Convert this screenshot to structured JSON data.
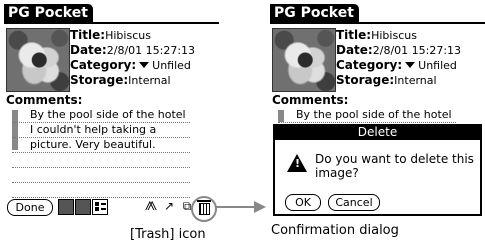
{
  "left_screen": {
    "app_title": "PG Pocket",
    "fields": {
      "title_label": "Title:",
      "title_value": "Hibiscus",
      "date_label": "Date:",
      "date_value": "2/8/01 15:27:13",
      "category_label": "Category:",
      "category_value": "Unfiled",
      "storage_label": "Storage:",
      "storage_value": "Internal"
    },
    "comments_label": "Comments:",
    "comment_lines": [
      "By the pool side of the hotel",
      "I couldn't help taking a",
      "picture. Very beautiful."
    ],
    "done_label": "Done",
    "toolbar_icons": [
      "list-view-icon",
      "thumbnail-view-icon",
      "detail-view-icon",
      "beam-icon",
      "export-icon",
      "copy-icon",
      "trash-icon"
    ]
  },
  "right_screen": {
    "app_title": "PG Pocket",
    "fields": {
      "title_label": "Title:",
      "title_value": "Hibiscus",
      "date_label": "Date:",
      "date_value": "2/8/01 15:27:13",
      "category_label": "Category:",
      "category_value": "Unfiled",
      "storage_label": "Storage:",
      "storage_value": "Internal"
    },
    "comments_label": "Comments:",
    "comment_first_line": "By the pool side of the hotel",
    "dialog": {
      "title": "Delete",
      "message": "Do you want to delete this image?",
      "ok_label": "OK",
      "cancel_label": "Cancel"
    }
  },
  "captions": {
    "trash": "[Trash] icon",
    "confirmation": "Confirmation dialog"
  }
}
